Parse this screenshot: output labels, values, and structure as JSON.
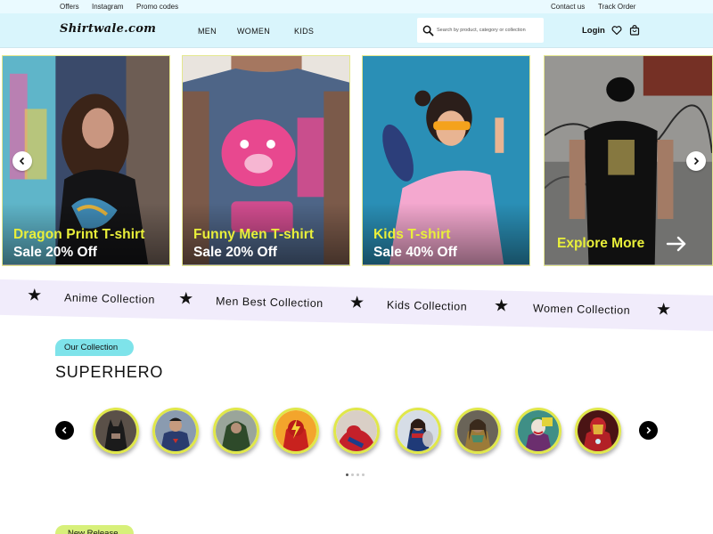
{
  "topbar": {
    "offers": "Offers",
    "instagram": "Instagram",
    "promo": "Promo codes",
    "contact": "Contact us",
    "track": "Track Order"
  },
  "header": {
    "logo": "Shirtwale.com",
    "nav": [
      "MEN",
      "WOMEN",
      "KIDS"
    ],
    "search_placeholder": "Search by product, category or collection",
    "login": "Login"
  },
  "hero": {
    "cards": [
      {
        "title": "Dragon Print T-shirt",
        "sale": "Sale 20% Off"
      },
      {
        "title": "Funny Men T-shirt",
        "sale": "Sale 20% Off"
      },
      {
        "title": "Kids T-shirt",
        "sale": "Sale 40% Off"
      }
    ],
    "explore": "Explore More"
  },
  "ribbon": {
    "items": [
      "Anime Collection",
      "Men Best Collection",
      "Kids Collection",
      "Women Collection"
    ]
  },
  "collection": {
    "badge": "Our Collection",
    "title": "SUPERHERO",
    "heroes": [
      "batman",
      "superman",
      "arrow",
      "flash",
      "spider-man",
      "wonder-woman",
      "aquaman",
      "joker",
      "iron-man"
    ],
    "page_count": 4,
    "active_page": 1
  },
  "next_section": {
    "badge": "New Release"
  },
  "colors": {
    "header_bg": "#d9f5fc",
    "accent_yellow": "#e9ef3a",
    "badge_teal": "#7ee3ea",
    "ribbon_bg": "#f1ecfb"
  }
}
